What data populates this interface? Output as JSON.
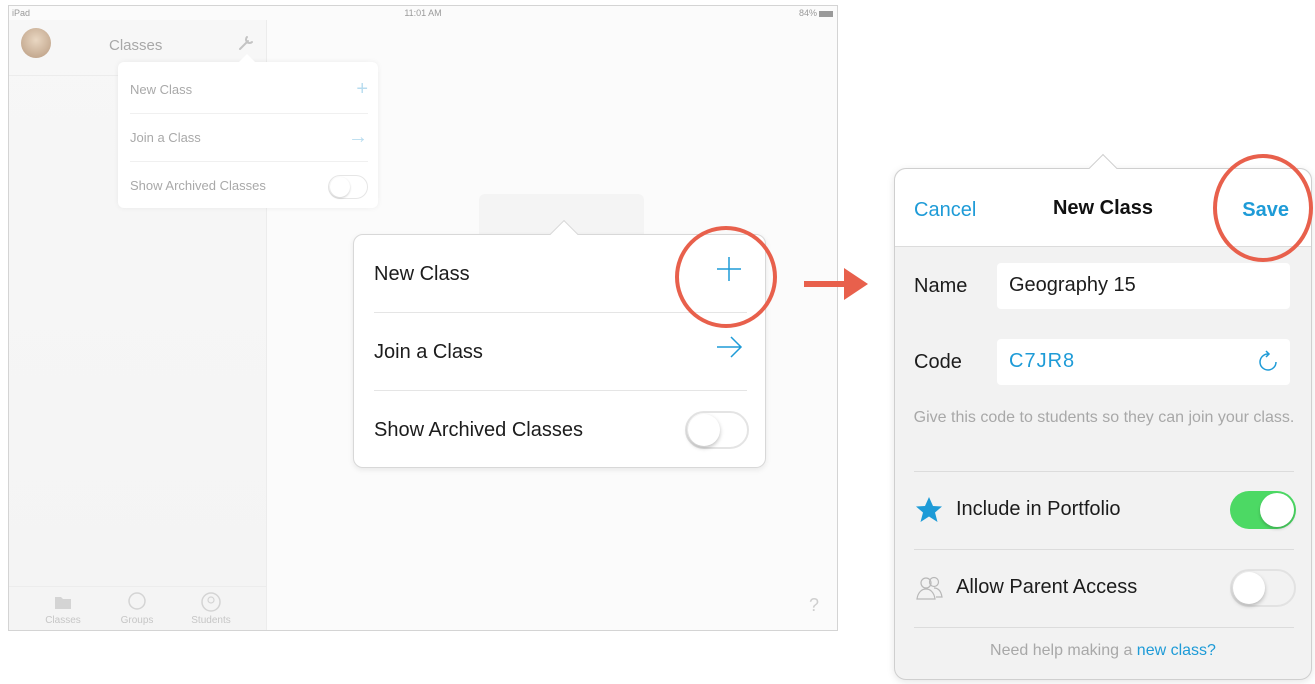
{
  "status_bar": {
    "device": "iPad",
    "time": "11:01 AM",
    "battery": "84%"
  },
  "sidebar": {
    "title": "Classes",
    "tabs": [
      {
        "label": "Classes"
      },
      {
        "label": "Groups"
      },
      {
        "label": "Students"
      }
    ]
  },
  "help_glyph": "?",
  "small_menu": {
    "items": [
      {
        "label": "New Class"
      },
      {
        "label": "Join a Class"
      },
      {
        "label": "Show Archived Classes"
      }
    ]
  },
  "zoom_menu": {
    "items": [
      {
        "label": "New Class"
      },
      {
        "label": "Join a Class"
      },
      {
        "label": "Show Archived Classes"
      }
    ]
  },
  "dialog": {
    "cancel": "Cancel",
    "title": "New Class",
    "save": "Save",
    "name_label": "Name",
    "name_value": "Geography 15",
    "code_label": "Code",
    "code_value": "C7JR8",
    "hint": "Give this code to students so they can join your class.",
    "portfolio_label": "Include in Portfolio",
    "portfolio_on": true,
    "parent_label": "Allow Parent Access",
    "parent_on": false,
    "help_text": "Need help making a ",
    "help_link": "new class?"
  },
  "colors": {
    "accent": "#1e9bd7",
    "highlight": "#e8604c",
    "toggle_on": "#4cd964"
  },
  "icons": [
    "wrench-icon",
    "plus-icon",
    "arrow-right-icon",
    "refresh-icon",
    "star-icon",
    "parents-icon",
    "folder-icon",
    "chat-icon",
    "person-icon",
    "question-icon"
  ]
}
